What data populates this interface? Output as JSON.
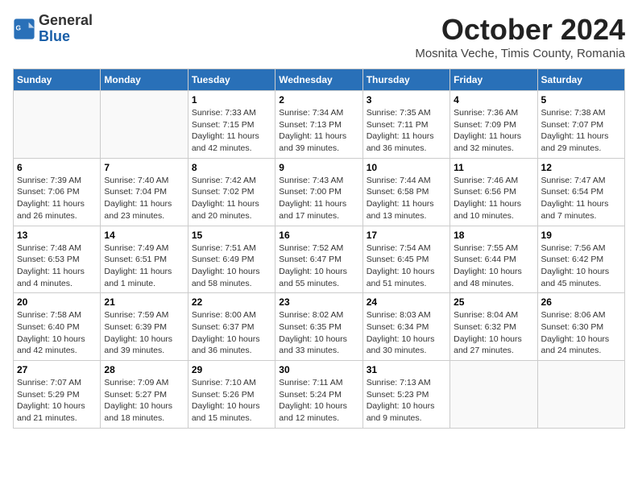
{
  "header": {
    "logo_general": "General",
    "logo_blue": "Blue",
    "month_title": "October 2024",
    "subtitle": "Mosnita Veche, Timis County, Romania"
  },
  "weekdays": [
    "Sunday",
    "Monday",
    "Tuesday",
    "Wednesday",
    "Thursday",
    "Friday",
    "Saturday"
  ],
  "weeks": [
    [
      {
        "day": "",
        "sunrise": "",
        "sunset": "",
        "daylight": ""
      },
      {
        "day": "",
        "sunrise": "",
        "sunset": "",
        "daylight": ""
      },
      {
        "day": "1",
        "sunrise": "Sunrise: 7:33 AM",
        "sunset": "Sunset: 7:15 PM",
        "daylight": "Daylight: 11 hours and 42 minutes."
      },
      {
        "day": "2",
        "sunrise": "Sunrise: 7:34 AM",
        "sunset": "Sunset: 7:13 PM",
        "daylight": "Daylight: 11 hours and 39 minutes."
      },
      {
        "day": "3",
        "sunrise": "Sunrise: 7:35 AM",
        "sunset": "Sunset: 7:11 PM",
        "daylight": "Daylight: 11 hours and 36 minutes."
      },
      {
        "day": "4",
        "sunrise": "Sunrise: 7:36 AM",
        "sunset": "Sunset: 7:09 PM",
        "daylight": "Daylight: 11 hours and 32 minutes."
      },
      {
        "day": "5",
        "sunrise": "Sunrise: 7:38 AM",
        "sunset": "Sunset: 7:07 PM",
        "daylight": "Daylight: 11 hours and 29 minutes."
      }
    ],
    [
      {
        "day": "6",
        "sunrise": "Sunrise: 7:39 AM",
        "sunset": "Sunset: 7:06 PM",
        "daylight": "Daylight: 11 hours and 26 minutes."
      },
      {
        "day": "7",
        "sunrise": "Sunrise: 7:40 AM",
        "sunset": "Sunset: 7:04 PM",
        "daylight": "Daylight: 11 hours and 23 minutes."
      },
      {
        "day": "8",
        "sunrise": "Sunrise: 7:42 AM",
        "sunset": "Sunset: 7:02 PM",
        "daylight": "Daylight: 11 hours and 20 minutes."
      },
      {
        "day": "9",
        "sunrise": "Sunrise: 7:43 AM",
        "sunset": "Sunset: 7:00 PM",
        "daylight": "Daylight: 11 hours and 17 minutes."
      },
      {
        "day": "10",
        "sunrise": "Sunrise: 7:44 AM",
        "sunset": "Sunset: 6:58 PM",
        "daylight": "Daylight: 11 hours and 13 minutes."
      },
      {
        "day": "11",
        "sunrise": "Sunrise: 7:46 AM",
        "sunset": "Sunset: 6:56 PM",
        "daylight": "Daylight: 11 hours and 10 minutes."
      },
      {
        "day": "12",
        "sunrise": "Sunrise: 7:47 AM",
        "sunset": "Sunset: 6:54 PM",
        "daylight": "Daylight: 11 hours and 7 minutes."
      }
    ],
    [
      {
        "day": "13",
        "sunrise": "Sunrise: 7:48 AM",
        "sunset": "Sunset: 6:53 PM",
        "daylight": "Daylight: 11 hours and 4 minutes."
      },
      {
        "day": "14",
        "sunrise": "Sunrise: 7:49 AM",
        "sunset": "Sunset: 6:51 PM",
        "daylight": "Daylight: 11 hours and 1 minute."
      },
      {
        "day": "15",
        "sunrise": "Sunrise: 7:51 AM",
        "sunset": "Sunset: 6:49 PM",
        "daylight": "Daylight: 10 hours and 58 minutes."
      },
      {
        "day": "16",
        "sunrise": "Sunrise: 7:52 AM",
        "sunset": "Sunset: 6:47 PM",
        "daylight": "Daylight: 10 hours and 55 minutes."
      },
      {
        "day": "17",
        "sunrise": "Sunrise: 7:54 AM",
        "sunset": "Sunset: 6:45 PM",
        "daylight": "Daylight: 10 hours and 51 minutes."
      },
      {
        "day": "18",
        "sunrise": "Sunrise: 7:55 AM",
        "sunset": "Sunset: 6:44 PM",
        "daylight": "Daylight: 10 hours and 48 minutes."
      },
      {
        "day": "19",
        "sunrise": "Sunrise: 7:56 AM",
        "sunset": "Sunset: 6:42 PM",
        "daylight": "Daylight: 10 hours and 45 minutes."
      }
    ],
    [
      {
        "day": "20",
        "sunrise": "Sunrise: 7:58 AM",
        "sunset": "Sunset: 6:40 PM",
        "daylight": "Daylight: 10 hours and 42 minutes."
      },
      {
        "day": "21",
        "sunrise": "Sunrise: 7:59 AM",
        "sunset": "Sunset: 6:39 PM",
        "daylight": "Daylight: 10 hours and 39 minutes."
      },
      {
        "day": "22",
        "sunrise": "Sunrise: 8:00 AM",
        "sunset": "Sunset: 6:37 PM",
        "daylight": "Daylight: 10 hours and 36 minutes."
      },
      {
        "day": "23",
        "sunrise": "Sunrise: 8:02 AM",
        "sunset": "Sunset: 6:35 PM",
        "daylight": "Daylight: 10 hours and 33 minutes."
      },
      {
        "day": "24",
        "sunrise": "Sunrise: 8:03 AM",
        "sunset": "Sunset: 6:34 PM",
        "daylight": "Daylight: 10 hours and 30 minutes."
      },
      {
        "day": "25",
        "sunrise": "Sunrise: 8:04 AM",
        "sunset": "Sunset: 6:32 PM",
        "daylight": "Daylight: 10 hours and 27 minutes."
      },
      {
        "day": "26",
        "sunrise": "Sunrise: 8:06 AM",
        "sunset": "Sunset: 6:30 PM",
        "daylight": "Daylight: 10 hours and 24 minutes."
      }
    ],
    [
      {
        "day": "27",
        "sunrise": "Sunrise: 7:07 AM",
        "sunset": "Sunset: 5:29 PM",
        "daylight": "Daylight: 10 hours and 21 minutes."
      },
      {
        "day": "28",
        "sunrise": "Sunrise: 7:09 AM",
        "sunset": "Sunset: 5:27 PM",
        "daylight": "Daylight: 10 hours and 18 minutes."
      },
      {
        "day": "29",
        "sunrise": "Sunrise: 7:10 AM",
        "sunset": "Sunset: 5:26 PM",
        "daylight": "Daylight: 10 hours and 15 minutes."
      },
      {
        "day": "30",
        "sunrise": "Sunrise: 7:11 AM",
        "sunset": "Sunset: 5:24 PM",
        "daylight": "Daylight: 10 hours and 12 minutes."
      },
      {
        "day": "31",
        "sunrise": "Sunrise: 7:13 AM",
        "sunset": "Sunset: 5:23 PM",
        "daylight": "Daylight: 10 hours and 9 minutes."
      },
      {
        "day": "",
        "sunrise": "",
        "sunset": "",
        "daylight": ""
      },
      {
        "day": "",
        "sunrise": "",
        "sunset": "",
        "daylight": ""
      }
    ]
  ]
}
